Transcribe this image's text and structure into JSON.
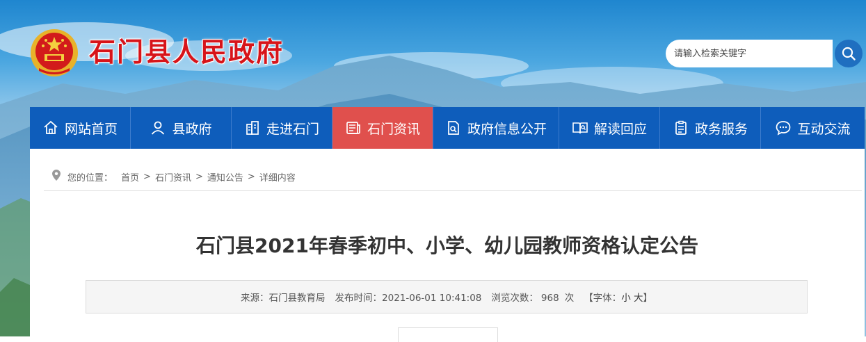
{
  "header": {
    "site_title": "石门县人民政府",
    "logo_icon": "national-emblem-icon",
    "search": {
      "placeholder": "请输入检索关键字",
      "icon": "search-icon"
    }
  },
  "nav": {
    "items": [
      {
        "label": "网站首页",
        "icon": "home-icon",
        "active": false
      },
      {
        "label": "县政府",
        "icon": "user-icon",
        "active": false
      },
      {
        "label": "走进石门",
        "icon": "building-icon",
        "active": false
      },
      {
        "label": "石门资讯",
        "icon": "news-icon",
        "active": true
      },
      {
        "label": "政府信息公开",
        "icon": "document-search-icon",
        "active": false
      },
      {
        "label": "解读回应",
        "icon": "book-search-icon",
        "active": false
      },
      {
        "label": "政务服务",
        "icon": "clipboard-icon",
        "active": false
      },
      {
        "label": "互动交流",
        "icon": "chat-icon",
        "active": false
      }
    ],
    "colors": {
      "background": "#0e5dbb",
      "active": "#e0504d"
    }
  },
  "breadcrumb": {
    "prefix": "您的位置：",
    "items": [
      "首页",
      "石门资讯",
      "通知公告",
      "详细内容"
    ],
    "separator": ">"
  },
  "article": {
    "title": "石门县2021年春季初中、小学、幼儿园教师资格认定公告",
    "meta": {
      "source_label": "来源：",
      "source": "石门县教育局",
      "date_label": "发布时间：",
      "date": "2021-06-01 10:41:08",
      "views_label": "浏览次数：",
      "views": "968",
      "views_unit": "次",
      "font_label": "【字体：",
      "font_small": "小",
      "font_large": "大",
      "font_close": "】"
    }
  }
}
